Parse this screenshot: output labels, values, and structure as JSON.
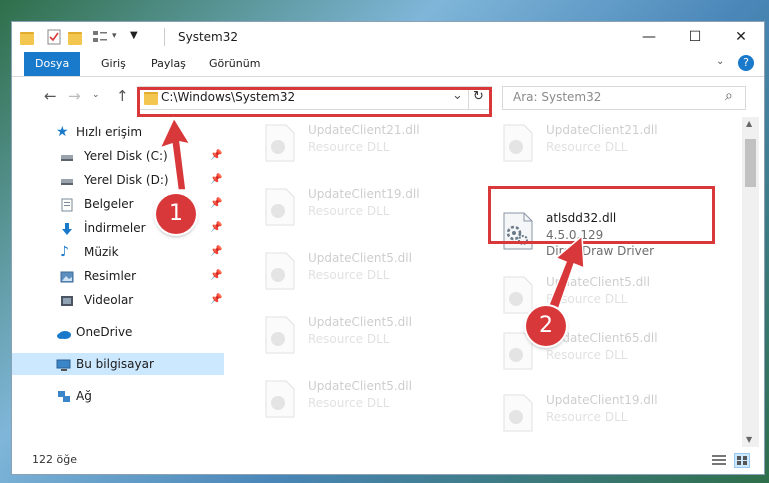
{
  "window": {
    "title": "System32",
    "minimize_glyph": "—",
    "maximize_glyph": "☐",
    "close_glyph": "✕"
  },
  "ribbon": {
    "tabs": [
      {
        "label": "Dosya",
        "active": true
      },
      {
        "label": "Giriş",
        "active": false
      },
      {
        "label": "Paylaş",
        "active": false
      },
      {
        "label": "Görünüm",
        "active": false
      }
    ]
  },
  "address": {
    "path": "C:\\Windows\\System32",
    "back_glyph": "←",
    "forward_glyph": "→",
    "up_glyph": "↑",
    "dropdown_glyph": "⌄",
    "refresh_glyph": "↻"
  },
  "search": {
    "placeholder": "Ara: System32",
    "icon_glyph": "⌕"
  },
  "nav": {
    "quick_access": "Hızlı erişim",
    "items": [
      {
        "label": "Yerel Disk (C:)",
        "icon": "drive-icon"
      },
      {
        "label": "Yerel Disk (D:)",
        "icon": "drive-icon"
      },
      {
        "label": "Belgeler",
        "icon": "documents-icon"
      },
      {
        "label": "İndirmeler",
        "icon": "downloads-icon"
      },
      {
        "label": "Müzik",
        "icon": "music-icon"
      },
      {
        "label": "Resimler",
        "icon": "pictures-icon"
      },
      {
        "label": "Videolar",
        "icon": "videos-icon"
      }
    ],
    "pin_glyph": "📌",
    "onedrive": "OneDrive",
    "this_pc": "Bu bilgisayar",
    "network": "Ağ"
  },
  "files": {
    "col_left": [
      {
        "name": "UpdateClient21.dll",
        "desc": "Resource DLL"
      },
      {
        "name": "UpdateClient19.dll",
        "desc": "Resource DLL"
      },
      {
        "name": "UpdateClient5.dll",
        "desc": "Resource DLL"
      },
      {
        "name": "UpdateClient5.dll",
        "desc": "Resource DLL"
      },
      {
        "name": "UpdateClient5.dll",
        "desc": "Resource DLL"
      }
    ],
    "col_right": [
      {
        "name": "UpdateClient21.dll",
        "desc": "Resource DLL"
      },
      {
        "name": "UpdateClient5.dll",
        "desc": "Resource DLL"
      },
      {
        "name": "UpdateClient65.dll",
        "desc": "Resource DLL"
      },
      {
        "name": "UpdateClient19.dll",
        "desc": "Resource DLL"
      }
    ],
    "highlight": {
      "name": "atlsdd32.dll",
      "version": "4.5.0.129",
      "description": "DirectDraw Driver"
    }
  },
  "status": {
    "count": "122 öğe"
  },
  "annotations": {
    "badge1": "1",
    "badge2": "2",
    "color": "#d9383a"
  },
  "colors": {
    "accent": "#1979ca",
    "selected": "#cce8ff"
  }
}
